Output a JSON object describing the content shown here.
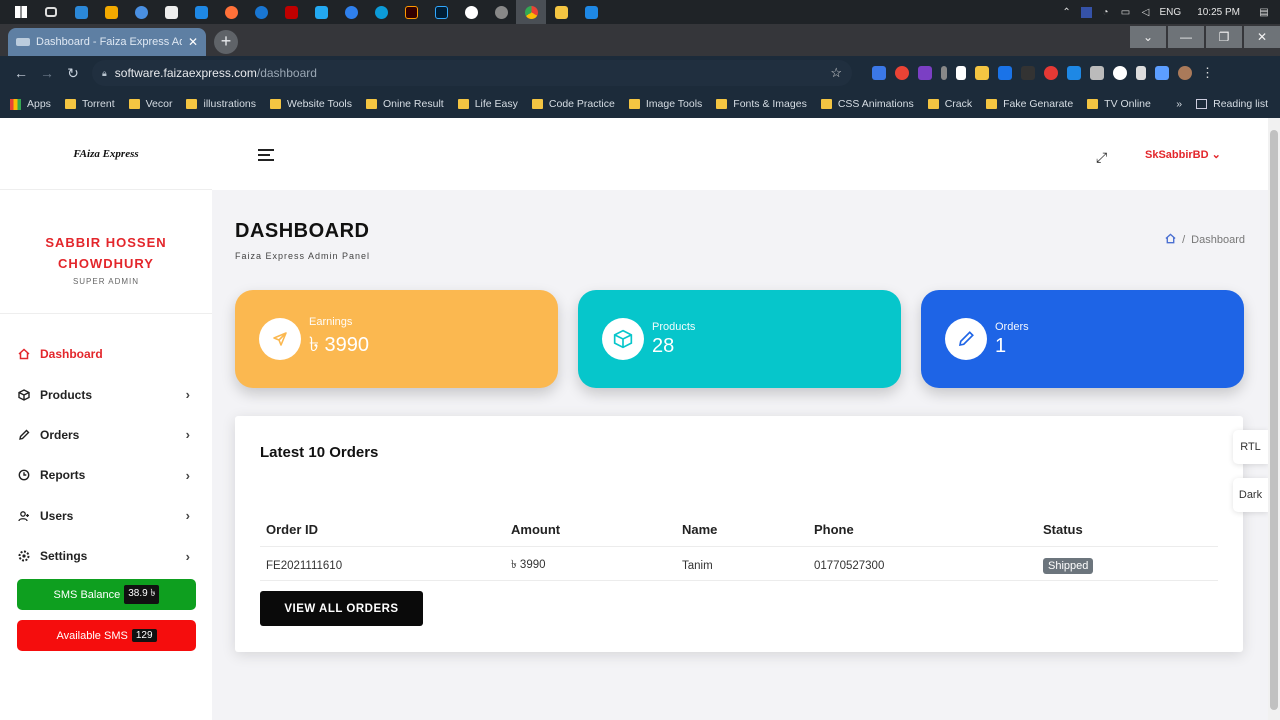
{
  "os": {
    "taskbar_apps": [
      "windows",
      "task-view",
      "files",
      "app-yellow",
      "app-blue",
      "epic",
      "notes",
      "app-blue-2",
      "firefox",
      "app-blue-3",
      "filezilla",
      "vscode",
      "app-blue-4",
      "edge",
      "illustrator",
      "photoshop",
      "app-circle",
      "app-circle-2",
      "chrome",
      "app-yellow-2",
      "app-blue-5"
    ],
    "language": "ENG",
    "time": "10:25 PM"
  },
  "browser": {
    "tab_title": "Dashboard - Faiza Express Admin",
    "url_host": "software.faizaexpress.com",
    "url_path": "/dashboard",
    "bookmarks": [
      "Apps",
      "Torrent",
      "Vecor",
      "illustrations",
      "Website Tools",
      "Onine Result",
      "Life Easy",
      "Code Practice",
      "Image Tools",
      "Fonts & Images",
      "CSS Animations",
      "Crack",
      "Fake Genarate",
      "TV Online"
    ],
    "reading_list": "Reading list"
  },
  "sidebar": {
    "brand": "FAiza Express",
    "profile_name": "SABBIR HOSSEN CHOWDHURY",
    "profile_role": "SUPER ADMIN",
    "menu": [
      {
        "label": "Dashboard",
        "icon": "home-icon"
      },
      {
        "label": "Products",
        "icon": "box-icon"
      },
      {
        "label": "Orders",
        "icon": "pencil-icon"
      },
      {
        "label": "Reports",
        "icon": "clock-icon"
      },
      {
        "label": "Users",
        "icon": "user-icon"
      },
      {
        "label": "Settings",
        "icon": "gear-icon"
      }
    ],
    "sms_balance_label": "SMS Balance",
    "sms_balance_value": "38.9 ৳",
    "available_sms_label": "Available SMS",
    "available_sms_value": "129"
  },
  "header": {
    "user": "SkSabbirBD"
  },
  "page": {
    "title": "DASHBOARD",
    "subtitle": "Faiza Express Admin Panel",
    "breadcrumb": "Dashboard"
  },
  "cards": [
    {
      "label": "Earnings",
      "value": "৳ 3990",
      "color": "#fbb850"
    },
    {
      "label": "Products",
      "value": "28",
      "color": "#06c6cb"
    },
    {
      "label": "Orders",
      "value": "1",
      "color": "#1e64e6"
    }
  ],
  "orders_panel": {
    "title": "Latest 10 Orders",
    "columns": [
      "Order ID",
      "Amount",
      "Name",
      "Phone",
      "Status"
    ],
    "rows": [
      {
        "order_id": "FE2021111610",
        "amount": "৳ 3990",
        "name": "Tanim",
        "phone": "01770527300",
        "status": "Shipped"
      }
    ],
    "view_all": "VIEW ALL ORDERS"
  },
  "toggles": {
    "rtl": "RTL",
    "dark": "Dark"
  },
  "colors": {
    "accent_red": "#e3262b",
    "sms_green": "#0e9f1f",
    "sms_red": "#f50d0d"
  }
}
